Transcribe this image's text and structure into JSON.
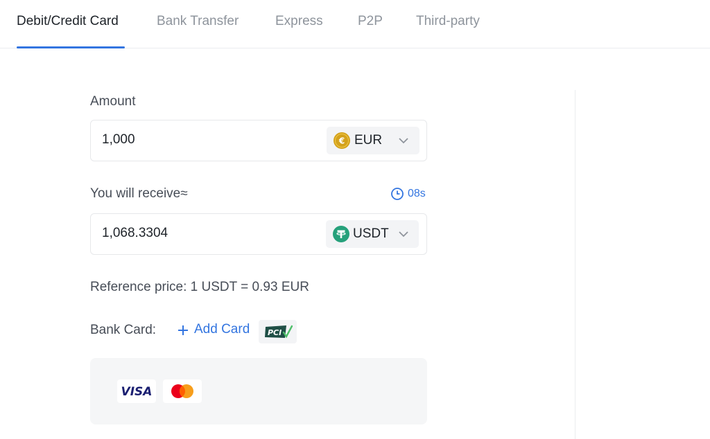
{
  "tabs": [
    {
      "label": "Debit/Credit Card",
      "active": true
    },
    {
      "label": "Bank Transfer",
      "active": false
    },
    {
      "label": "Express",
      "active": false
    },
    {
      "label": "P2P",
      "active": false
    },
    {
      "label": "Third-party",
      "active": false
    }
  ],
  "amount": {
    "label": "Amount",
    "value": "1,000",
    "currency": {
      "code": "EUR",
      "icon": "euro-coin-icon",
      "color": "#d4a21c"
    }
  },
  "receive": {
    "label": "You will receive≈",
    "timer": "08s",
    "value": "1,068.3304",
    "currency": {
      "code": "USDT",
      "icon": "tether-icon",
      "color": "#26a17b"
    }
  },
  "reference_price": "Reference price: 1 USDT = 0.93 EUR",
  "bank_card": {
    "label": "Bank Card:",
    "add_label": "Add Card",
    "pci_badge": "PCI",
    "brands": [
      "VISA",
      "Mastercard"
    ]
  },
  "colors": {
    "accent": "#3375e0",
    "text_primary": "#1e2329",
    "text_secondary": "#474d57",
    "text_muted": "#8e949c"
  }
}
